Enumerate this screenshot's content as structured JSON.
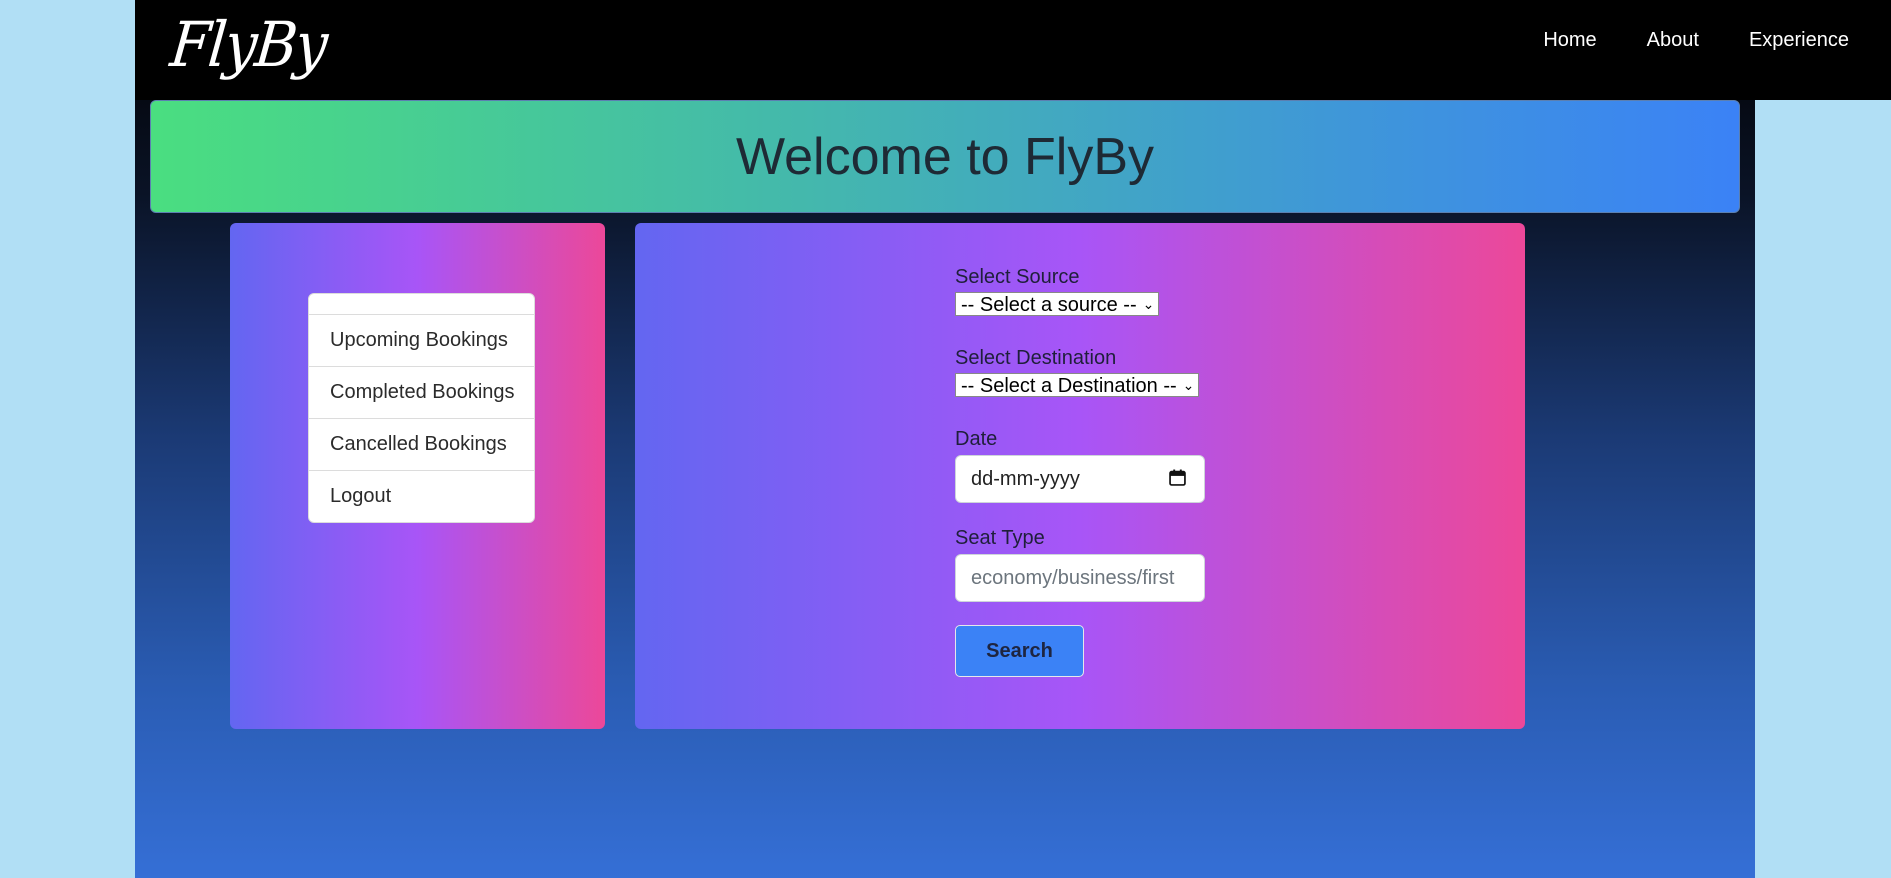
{
  "navbar": {
    "logo_text": "FlyBy",
    "links": [
      "Home",
      "About",
      "Experience"
    ]
  },
  "banner": {
    "title": "Welcome to FlyBy"
  },
  "sidebar": {
    "items": [
      "Upcoming Bookings",
      "Completed Bookings",
      "Cancelled Bookings",
      "Logout"
    ]
  },
  "form": {
    "source_label": "Select Source",
    "source_selected": "-- Select a source --",
    "destination_label": "Select Destination",
    "destination_selected": "-- Select a Destination --",
    "date_label": "Date",
    "date_value": "dd-mm-yyyy",
    "seat_label": "Seat Type",
    "seat_placeholder": "economy/business/first",
    "search_label": "Search"
  },
  "colors": {
    "page_background": "#b1dff5",
    "navbar": "#000000",
    "banner_gradient": [
      "#4ade80",
      "#3b82f6"
    ],
    "panel_gradient": [
      "#6366f1",
      "#a855f7",
      "#ec4899"
    ],
    "search_button": "#3b82f6"
  },
  "icons": {
    "date_picker": "calendar-icon",
    "select_arrow": "chevron-down-icon"
  }
}
